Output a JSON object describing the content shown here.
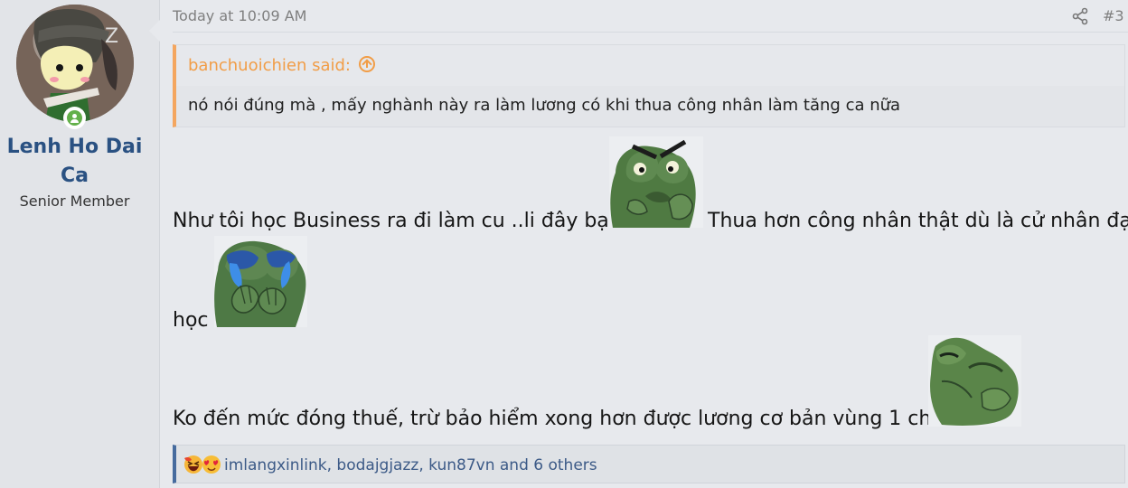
{
  "post": {
    "author": {
      "name_line1": "Lenh Ho Dai",
      "name_line2": "Ca",
      "title": "Senior Member",
      "status": "online"
    },
    "timestamp": "Today at 10:09 AM",
    "post_number": "#3",
    "quote": {
      "author_label": "banchuoichien said:",
      "text": "nó nói đúng mà , mấy nghành này ra làm lương có khi thua công nhân làm tăng ca nữa"
    },
    "body": {
      "line1_before": "Như tôi học Business ra đi làm cu ..li đây bạn",
      "line1_after": "Thua hơn công nhân thật dù là cử nhân đại",
      "line2": "học",
      "line3": "Ko đến mức đóng thuế, trừ bảo hiểm xong hơn được lương cơ bản vùng 1 chút"
    },
    "stickers": [
      "angry-frog-sticker",
      "crying-frog-sticker",
      "lying-frog-sticker"
    ],
    "reactions": {
      "icons": [
        "haha-reaction-icon",
        "love-reaction-icon"
      ],
      "text": "imlangxinlink, bodajgjazz, kun87vn and 6 others"
    }
  }
}
